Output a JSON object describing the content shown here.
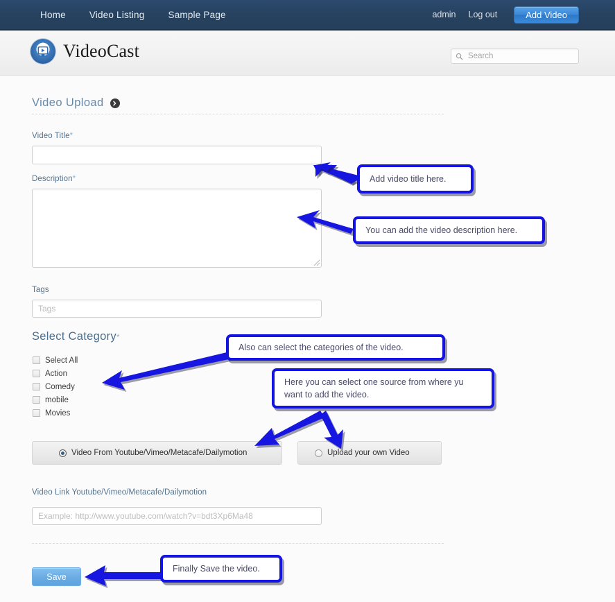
{
  "topnav": {
    "links": [
      {
        "label": "Home"
      },
      {
        "label": "Video Listing"
      },
      {
        "label": "Sample Page"
      }
    ],
    "user": "admin",
    "logout": "Log out",
    "add_video": "Add Video"
  },
  "brand": {
    "name": "VideoCast",
    "logo_icon": "video-play-logo-icon"
  },
  "search": {
    "placeholder": "Search",
    "value": "",
    "icon": "search-icon"
  },
  "page": {
    "title": "Video Upload",
    "expand_icon": "chevron-right-icon"
  },
  "form": {
    "video_title": {
      "label": "Video Title",
      "required_mark": "*",
      "value": "",
      "placeholder": ""
    },
    "description": {
      "label": "Description",
      "required_mark": "*",
      "value": "",
      "placeholder": ""
    },
    "tags": {
      "label": "Tags",
      "value": "",
      "placeholder": "Tags"
    },
    "category": {
      "title": "Select Category",
      "required_mark": "*",
      "options": [
        {
          "label": "Select All",
          "checked": false
        },
        {
          "label": "Action",
          "checked": false
        },
        {
          "label": "Comedy",
          "checked": false
        },
        {
          "label": "mobile",
          "checked": false
        },
        {
          "label": "Movies",
          "checked": false
        }
      ]
    },
    "source": {
      "option_remote": "Video From Youtube/Vimeo/Metacafe/Dailymotion",
      "option_upload": "Upload your own Video",
      "selected": "remote"
    },
    "video_link": {
      "label": "Video Link Youtube/Vimeo/Metacafe/Dailymotion",
      "value": "",
      "placeholder": "Example: http://www.youtube.com/watch?v=bdt3Xp6Ma48"
    },
    "save_label": "Save"
  },
  "annotations": [
    {
      "id": "a1",
      "text": "Add video title here."
    },
    {
      "id": "a2",
      "text": "You can add the video description here."
    },
    {
      "id": "a3",
      "text": "Also can select the categories of the video."
    },
    {
      "id": "a4",
      "text": "Here you can select one source from where yu\nwant to add the video."
    },
    {
      "id": "a5",
      "text": "Finally Save the video."
    }
  ],
  "colors": {
    "topbar": "#274564",
    "accent_blue": "#3c87d6",
    "annotation_blue": "#1414e0",
    "label_blue": "#53738f",
    "save_blue": "#6aabe2"
  }
}
